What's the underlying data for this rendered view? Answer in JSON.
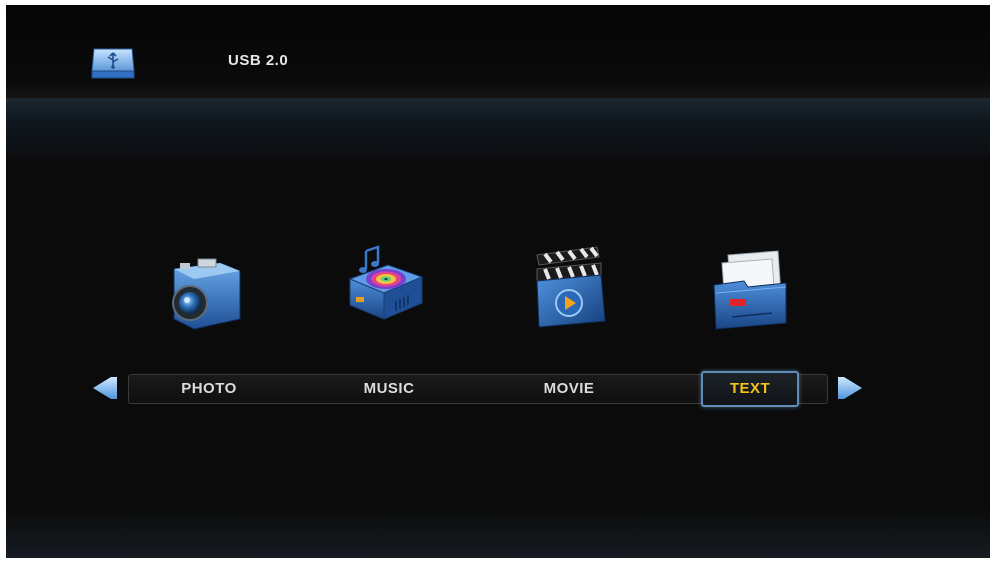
{
  "header": {
    "device_label": "USB 2.0",
    "device_icon": "usb-drive-icon"
  },
  "menu": {
    "items": [
      {
        "label": "PHOTO",
        "icon": "camera-icon"
      },
      {
        "label": "MUSIC",
        "icon": "music-player-icon"
      },
      {
        "label": "MOVIE",
        "icon": "clapperboard-icon"
      },
      {
        "label": "TEXT",
        "icon": "folder-document-icon"
      }
    ],
    "selected": "TEXT",
    "left_arrow_icon": "arrow-left-icon",
    "right_arrow_icon": "arrow-right-icon"
  },
  "colors": {
    "background": "#0b0b0b",
    "label": "#dcdcdc",
    "selected_label": "#f2c31a",
    "selection_border": "#5f8db8",
    "icon_blue": "#2f6fc4"
  }
}
